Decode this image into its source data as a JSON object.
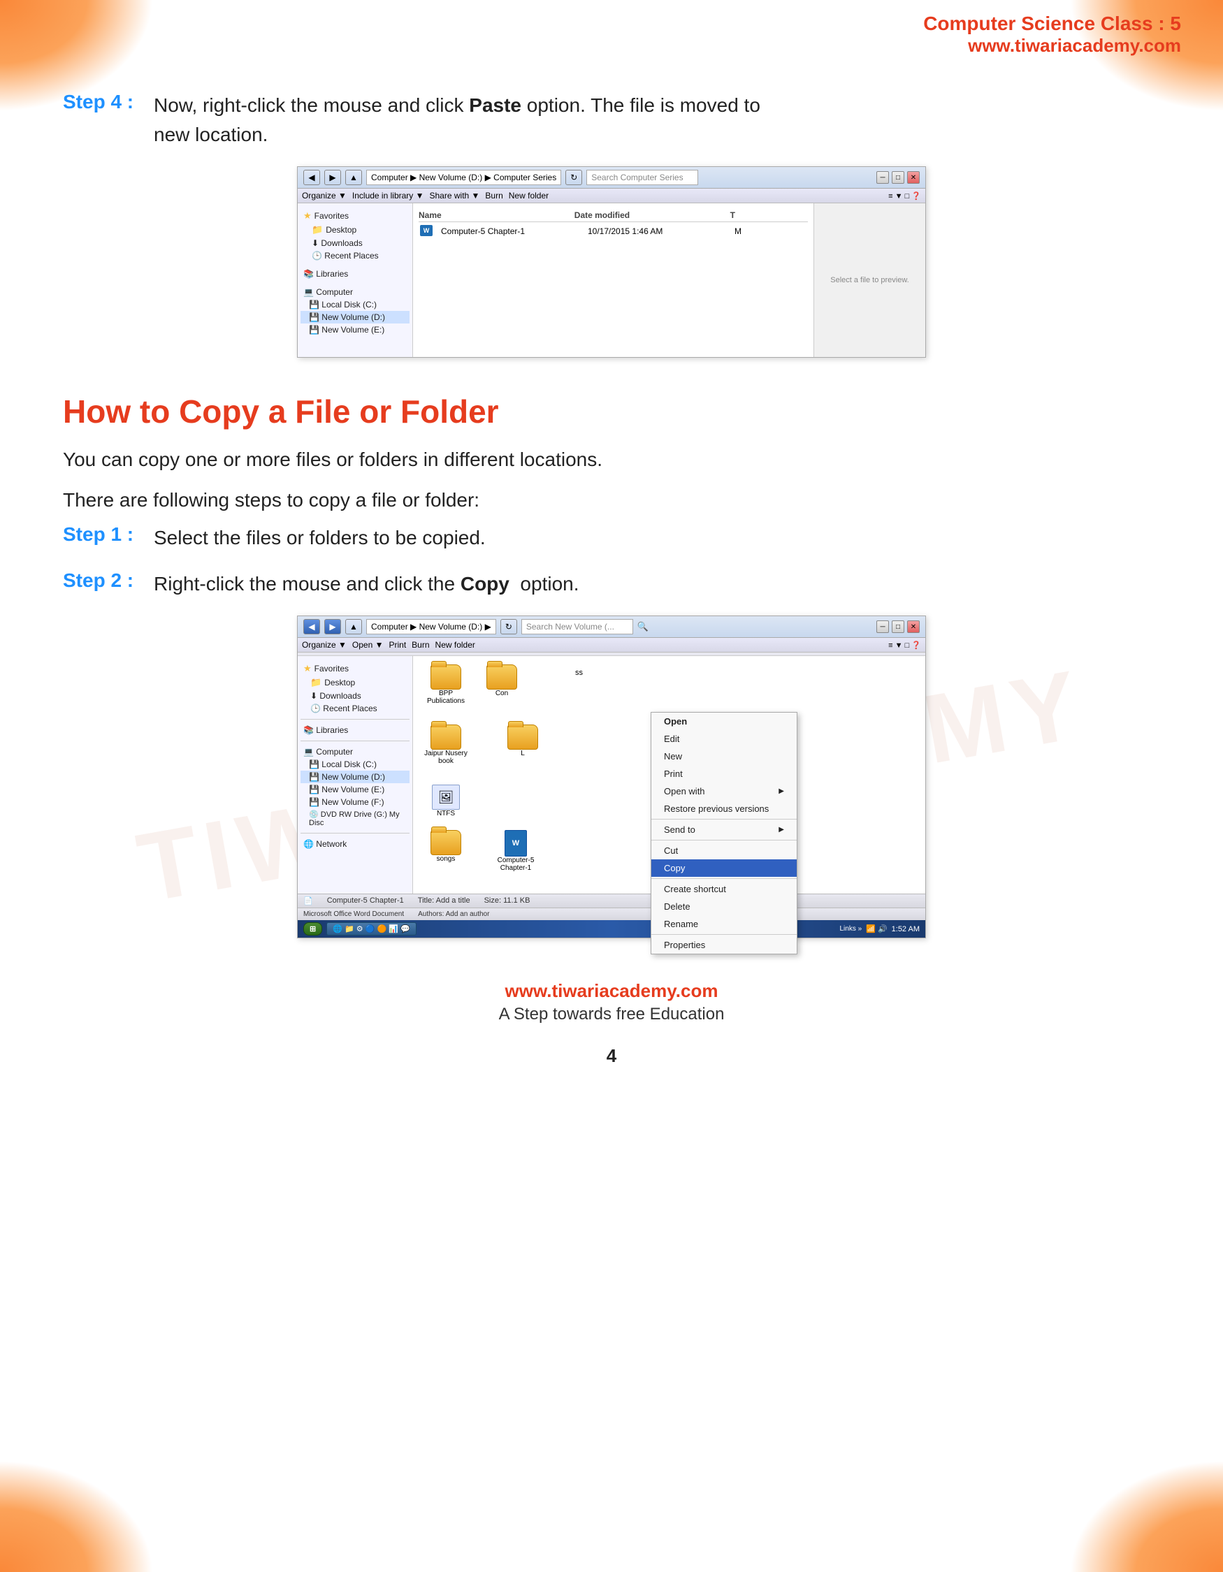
{
  "header": {
    "title": "Computer Science Class : 5",
    "url": "www.tiwariacademy.com"
  },
  "step4": {
    "label": "Step 4 :",
    "text": "Now, right-click the mouse and click ",
    "bold": "Paste",
    "text2": " option. The file is moved to new location."
  },
  "explorer1": {
    "titlebar": {
      "path": "Computer ▶ New Volume (D:) ▶ Computer Series",
      "search_placeholder": "Search Computer Series"
    },
    "toolbar": {
      "organize": "Organize ▼",
      "include": "Include in library ▼",
      "share": "Share with ▼",
      "burn": "Burn",
      "new_folder": "New folder"
    },
    "sidebar_items": [
      {
        "icon": "star",
        "label": "Favorites"
      },
      {
        "icon": "folder",
        "label": "Desktop"
      },
      {
        "icon": "download",
        "label": "Downloads"
      },
      {
        "icon": "recent",
        "label": "Recent Places"
      },
      {
        "icon": "library",
        "label": "Libraries"
      },
      {
        "icon": "computer",
        "label": "Computer"
      },
      {
        "icon": "disk",
        "label": "Local Disk (C:)"
      },
      {
        "icon": "disk",
        "label": "New Volume (D:)"
      },
      {
        "icon": "disk",
        "label": "New Volume (E:)"
      }
    ],
    "columns": [
      "Name",
      "Date modified",
      "T"
    ],
    "files": [
      {
        "name": "Computer-5 Chapter-1",
        "date": "10/17/2015 1:46 AM",
        "type": "M"
      }
    ],
    "preview_text": "Select a file to preview."
  },
  "section_title": "How to Copy a File or Folder",
  "intro_text1": "You can copy one or more files or folders in different locations.",
  "intro_text2": "There are following steps to copy a file or folder:",
  "step1": {
    "label": "Step 1 :",
    "text": "Select the files or folders to be copied."
  },
  "step2": {
    "label": "Step 2 :",
    "text": "Right-click the mouse and click the ",
    "bold": "Copy",
    "text2": " option."
  },
  "explorer2": {
    "titlebar": {
      "path": "Computer ▶ New Volume (D:) ▶",
      "search_placeholder": "Search New Volume (..."
    },
    "toolbar": {
      "organize": "Organize ▼",
      "open": "Open ▼",
      "print": "Print",
      "burn": "Burn",
      "new_folder": "New folder"
    },
    "sidebar_items": [
      {
        "icon": "star",
        "label": "Favorites"
      },
      {
        "icon": "folder",
        "label": "Desktop"
      },
      {
        "icon": "download",
        "label": "Downloads"
      },
      {
        "icon": "recent",
        "label": "Recent Places"
      },
      {
        "icon": "library",
        "label": "Libraries"
      },
      {
        "icon": "computer",
        "label": "Computer"
      },
      {
        "icon": "disk",
        "label": "Local Disk (C:)"
      },
      {
        "icon": "disk",
        "label": "New Volume (D:)"
      },
      {
        "icon": "disk",
        "label": "New Volume (E:)"
      },
      {
        "icon": "disk",
        "label": "New Volume (F:)"
      },
      {
        "icon": "dvd",
        "label": "DVD RW Drive (G:) My Disc"
      },
      {
        "icon": "network",
        "label": "Network"
      }
    ],
    "files": [
      {
        "name": "BPP Publications",
        "type": "folder"
      },
      {
        "name": "Jaipur Nusery book",
        "type": "folder"
      },
      {
        "name": "NTFS",
        "type": "image"
      },
      {
        "name": "songs",
        "type": "folder"
      },
      {
        "name": "Computer-5 Chapter-1",
        "type": "word"
      }
    ],
    "context_menu": {
      "items": [
        {
          "label": "Open",
          "bold": true
        },
        {
          "label": "Edit"
        },
        {
          "label": "New"
        },
        {
          "label": "Print"
        },
        {
          "label": "Open with",
          "arrow": true
        },
        {
          "label": "Restore previous versions"
        },
        {
          "label": "Send to",
          "arrow": true
        },
        {
          "label": "Cut"
        },
        {
          "label": "Copy",
          "highlighted": true
        },
        {
          "label": "Create shortcut"
        },
        {
          "label": "Delete"
        },
        {
          "label": "Rename"
        },
        {
          "label": "Properties"
        }
      ]
    },
    "status": {
      "file": "Computer-5 Chapter-1",
      "title": "Title: Add a title",
      "size": "Size: 11.1 KB",
      "type": "Microsoft Office Word Document",
      "authors": "Authors: Add an author"
    },
    "taskbar": {
      "time": "1:52 AM"
    }
  },
  "footer": {
    "url": "www.tiwariacademy.com",
    "tagline": "A Step towards free Education",
    "page_number": "4"
  },
  "watermark": "TIWARI ACADEMY"
}
